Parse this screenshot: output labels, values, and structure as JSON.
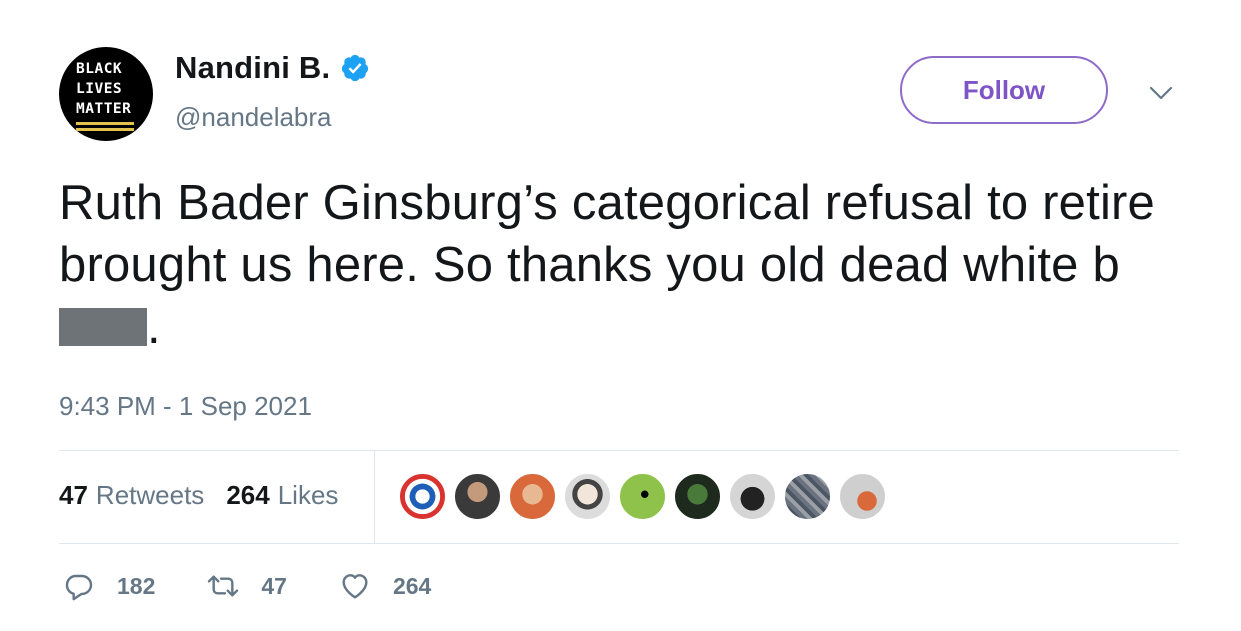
{
  "author": {
    "avatar_text": [
      "BLACK",
      "LIVES",
      "MATTER"
    ],
    "display_name": "Nandini B.",
    "handle": "@nandelabra",
    "verified": true
  },
  "follow_button": {
    "label": "Follow"
  },
  "tweet": {
    "text_before_redaction": "Ruth Bader Ginsburg’s categorical refusal to retire brought us here. So thanks you old dead white b",
    "text_after_redaction": ".",
    "timestamp": "9:43 PM - 1 Sep 2021"
  },
  "stats": {
    "retweets": {
      "count": "47",
      "label": "Retweets"
    },
    "likes": {
      "count": "264",
      "label": "Likes"
    }
  },
  "likers": [
    {
      "name": "liker-avatar-1",
      "color": "#e8d3b0"
    },
    {
      "name": "liker-avatar-2",
      "color": "#3a3a3a"
    },
    {
      "name": "liker-avatar-3",
      "color": "#d9683a"
    },
    {
      "name": "liker-avatar-4",
      "color": "#dcdcdc"
    },
    {
      "name": "liker-avatar-5",
      "color": "#8fc24a"
    },
    {
      "name": "liker-avatar-6",
      "color": "#1e2a1e"
    },
    {
      "name": "liker-avatar-7",
      "color": "#d5d5d5"
    },
    {
      "name": "liker-avatar-8",
      "color": "#6b7280"
    },
    {
      "name": "liker-avatar-9",
      "color": "#cfcfcf"
    }
  ],
  "actions": {
    "reply": {
      "icon": "reply-icon",
      "count": "182"
    },
    "retweet": {
      "icon": "retweet-icon",
      "count": "47"
    },
    "like": {
      "icon": "heart-icon",
      "count": "264"
    }
  },
  "colors": {
    "follow_accent": "#7d55c7",
    "verified_blue": "#1da1f2",
    "muted_text": "#657786",
    "redaction": "#6e7377"
  }
}
